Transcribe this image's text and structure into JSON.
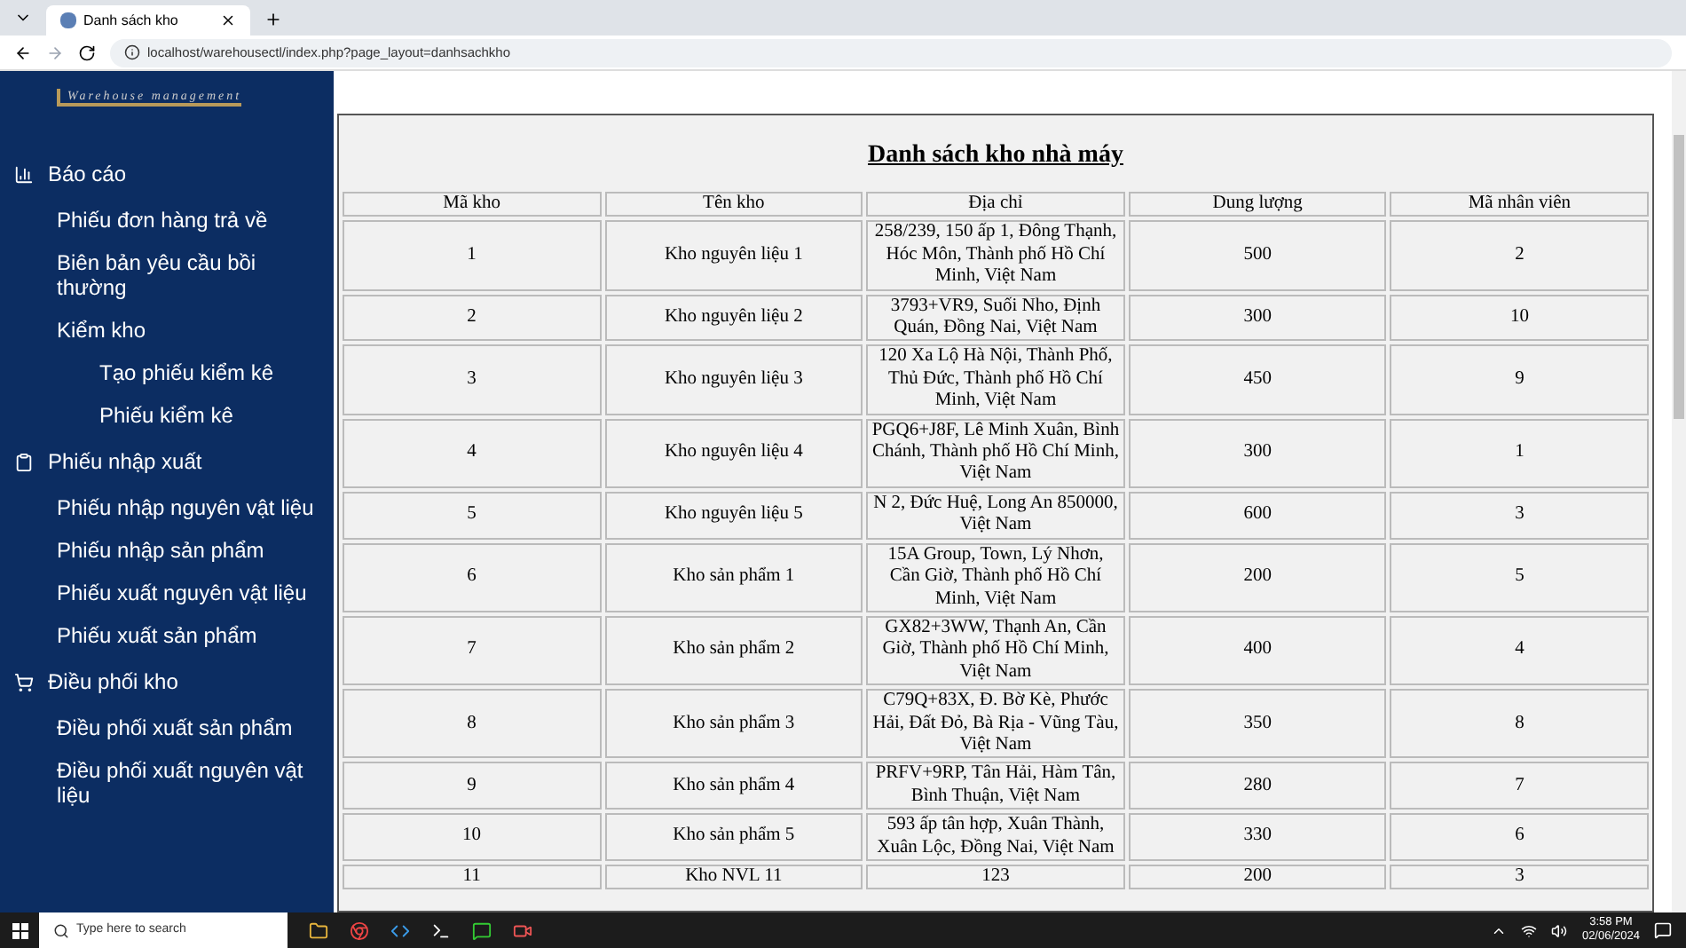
{
  "browser": {
    "tab_title": "Danh sách kho",
    "url": "localhost/warehousectl/index.php?page_layout=danhsachkho"
  },
  "logo": {
    "subtitle": "Warehouse management"
  },
  "sidebar": {
    "items": [
      {
        "label": "Báo cáo",
        "children": [
          {
            "label": "Phiếu đơn hàng trả về"
          },
          {
            "label": "Biên bản yêu cầu bồi thường"
          },
          {
            "label": "Kiểm kho",
            "children": [
              {
                "label": "Tạo phiếu kiểm kê"
              },
              {
                "label": "Phiếu kiểm kê"
              }
            ]
          }
        ]
      },
      {
        "label": "Phiếu nhập xuất",
        "children": [
          {
            "label": "Phiếu nhập nguyên vật liệu"
          },
          {
            "label": "Phiếu nhập sản phẩm"
          },
          {
            "label": "Phiếu xuất nguyên vật liệu"
          },
          {
            "label": "Phiếu xuất sản phẩm"
          }
        ]
      },
      {
        "label": "Điều phối kho",
        "children": [
          {
            "label": "Điều phối xuất sản phẩm"
          },
          {
            "label": "Điều phối xuất nguyên vật liệu"
          }
        ]
      }
    ]
  },
  "page_title": "Danh sách kho nhà máy",
  "table": {
    "columns": [
      "Mã kho",
      "Tên kho",
      "Địa chỉ",
      "Dung lượng",
      "Mã nhân viên"
    ],
    "rows": [
      [
        "1",
        "Kho nguyên liệu 1",
        "258/239, 150 ấp 1, Đông Thạnh, Hóc Môn, Thành phố Hồ Chí Minh, Việt Nam",
        "500",
        "2"
      ],
      [
        "2",
        "Kho nguyên liệu 2",
        "3793+VR9, Suối Nho, Định Quán, Đồng Nai, Việt Nam",
        "300",
        "10"
      ],
      [
        "3",
        "Kho nguyên liệu 3",
        "120 Xa Lộ Hà Nội, Thành Phố, Thủ Đức, Thành phố Hồ Chí Minh, Việt Nam",
        "450",
        "9"
      ],
      [
        "4",
        "Kho nguyên liệu 4",
        "PGQ6+J8F, Lê Minh Xuân, Bình Chánh, Thành phố Hồ Chí Minh, Việt Nam",
        "300",
        "1"
      ],
      [
        "5",
        "Kho nguyên liệu 5",
        "N 2, Đức Huệ, Long An 850000, Việt Nam",
        "600",
        "3"
      ],
      [
        "6",
        "Kho sản phẩm 1",
        "15A Group, Town, Lý Nhơn, Cần Giờ, Thành phố Hồ Chí Minh, Việt Nam",
        "200",
        "5"
      ],
      [
        "7",
        "Kho sản phẩm 2",
        "GX82+3WW, Thạnh An, Cần Giờ, Thành phố Hồ Chí Minh, Việt Nam",
        "400",
        "4"
      ],
      [
        "8",
        "Kho sản phẩm 3",
        "C79Q+83X, Đ. Bờ Kè, Phước Hải, Đất Đỏ, Bà Rịa - Vũng Tàu, Việt Nam",
        "350",
        "8"
      ],
      [
        "9",
        "Kho sản phẩm 4",
        "PRFV+9RP, Tân Hải, Hàm Tân, Bình Thuận, Việt Nam",
        "280",
        "7"
      ],
      [
        "10",
        "Kho sản phẩm 5",
        "593 ấp tân hợp, Xuân Thành, Xuân Lộc, Đồng Nai, Việt Nam",
        "330",
        "6"
      ],
      [
        "11",
        "Kho NVL 11",
        "123",
        "200",
        "3"
      ]
    ]
  },
  "taskbar": {
    "search_placeholder": "Type here to search",
    "time": "3:58 PM",
    "date": "02/06/2024"
  }
}
